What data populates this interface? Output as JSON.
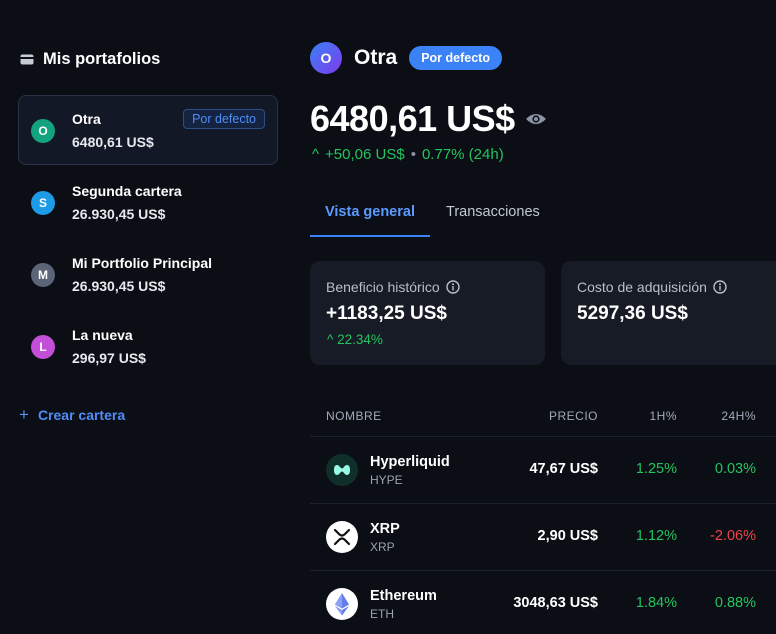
{
  "sidebar": {
    "title": "Mis portafolios",
    "icon": "wallet-icon",
    "portfolios": [
      {
        "initial": "O",
        "name": "Otra",
        "value": "6480,61 US$",
        "badge": "Por defecto",
        "color": "#14a37f"
      },
      {
        "initial": "S",
        "name": "Segunda cartera",
        "value": "26.930,45 US$",
        "color": "#1e9be6"
      },
      {
        "initial": "M",
        "name": "Mi Portfolio Principal",
        "value": "26.930,45 US$",
        "color": "#5b6577"
      },
      {
        "initial": "L",
        "name": "La nueva",
        "value": "296,97 US$",
        "color": "#c34fd8"
      }
    ],
    "create_label": "Crear cartera",
    "create_prefix": "+"
  },
  "header": {
    "initial": "O",
    "name": "Otra",
    "badge": "Por defecto",
    "balance": "6480,61 US$",
    "change_arrow": "^",
    "change_value": "+50,06 US$",
    "separator": "•",
    "change_pct": "0.77% (24h)"
  },
  "tabs": [
    {
      "label": "Vista general",
      "active": true
    },
    {
      "label": "Transacciones",
      "active": false
    }
  ],
  "cards": [
    {
      "label": "Beneficio histórico",
      "value": "+1183,25 US$",
      "sub": "^ 22.34%"
    },
    {
      "label": "Costo de adquisición",
      "value": "5297,36 US$",
      "sub": ""
    }
  ],
  "table": {
    "headers": {
      "name": "NOMBRE",
      "price": "PRECIO",
      "h1": "1H%",
      "h24": "24H%"
    },
    "rows": [
      {
        "name": "Hyperliquid",
        "symbol": "HYPE",
        "price": "47,67 US$",
        "h1": "1.25%",
        "h24": "0.03%",
        "h24_dir": "pos",
        "icon": "hyperliquid-icon"
      },
      {
        "name": "XRP",
        "symbol": "XRP",
        "price": "2,90 US$",
        "h1": "1.12%",
        "h24": "-2.06%",
        "h24_dir": "neg",
        "icon": "xrp-icon"
      },
      {
        "name": "Ethereum",
        "symbol": "ETH",
        "price": "3048,63 US$",
        "h1": "1.84%",
        "h24": "0.88%",
        "h24_dir": "pos",
        "icon": "ethereum-icon"
      }
    ]
  },
  "colors": {
    "accent": "#3b82f6",
    "positive": "#22c55e",
    "negative": "#ef4444",
    "background": "#0b0e15",
    "card": "#161b25"
  }
}
